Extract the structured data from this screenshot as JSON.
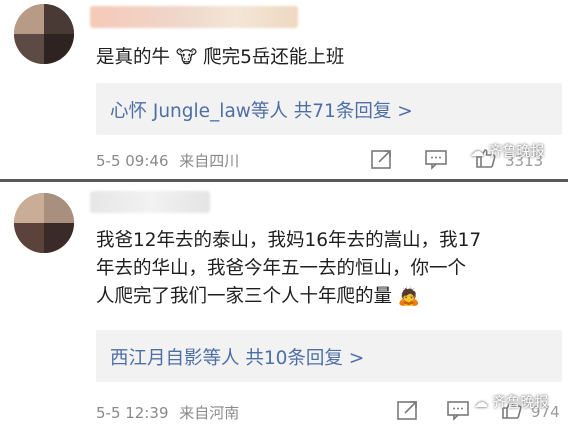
{
  "comments": [
    {
      "content": "是真的牛",
      "content_emoji": "🐮",
      "content_tail": "爬完5岳还能上班",
      "reply_text": "心怀 Jungle_law等人 共71条回复 >",
      "date": "5-5 09:46",
      "location": "来自四川",
      "likes": "3313",
      "watermark": "齐鲁晚报"
    },
    {
      "content_lines": [
        "我爸12年去的泰山，我妈16年去的嵩山，我17",
        "年去的华山，我爸今年五一去的恒山，你一个",
        "人爬完了我们一家三个人十年爬的量"
      ],
      "content_emoji": "🙇",
      "reply_text": "西江月自影等人 共10条回复 >",
      "date": "5-5 12:39",
      "location": "来自河南",
      "likes": "974",
      "watermark": "齐鲁晚报"
    }
  ],
  "icons": [
    "share-icon",
    "comment-icon",
    "like-icon",
    "weibo-logo-icon"
  ],
  "colors": {
    "link": "#4e6fa6",
    "meta": "#8a8a8a",
    "reply_bg": "#f2f2f2"
  }
}
